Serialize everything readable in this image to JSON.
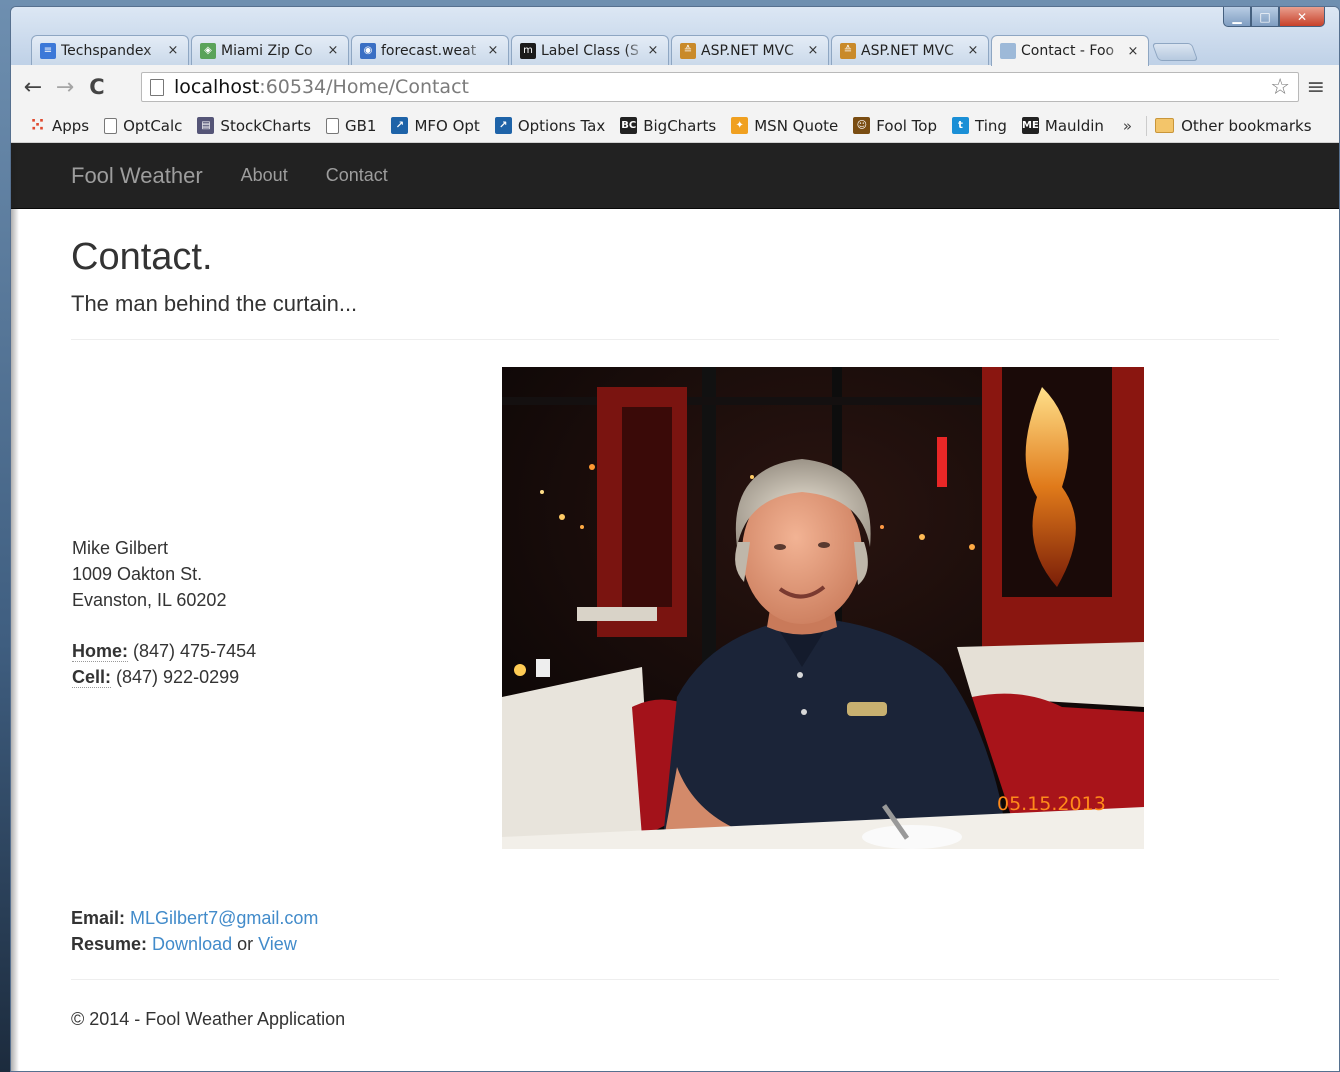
{
  "window": {
    "minimize": "▁",
    "maximize": "□",
    "close": "✕"
  },
  "tabs": [
    {
      "title": "Techspandex",
      "icon": "docs-icon",
      "color": "#3c78d8",
      "glyph": "≡"
    },
    {
      "title": "Miami Zip Co",
      "icon": "maps-icon",
      "color": "#5aa35a",
      "glyph": "◈"
    },
    {
      "title": "forecast.weat",
      "icon": "weather-icon",
      "color": "#3a6fc4",
      "glyph": "◉"
    },
    {
      "title": "Label Class (S",
      "icon": "m-icon",
      "color": "#1b1b1b",
      "glyph": "m"
    },
    {
      "title": "ASP.NET MVC",
      "icon": "stack-icon",
      "color": "#c98a2a",
      "glyph": "≙"
    },
    {
      "title": "ASP.NET MVC",
      "icon": "stack-icon",
      "color": "#c98a2a",
      "glyph": "≙"
    },
    {
      "title": "Contact - Foo",
      "icon": "page-icon",
      "color": "#9db9d8",
      "glyph": ""
    }
  ],
  "tab_close": "×",
  "toolbar": {
    "back": "←",
    "forward": "→",
    "reload": "C",
    "url_host": "localhost",
    "url_rest": ":60534/Home/Contact",
    "star": "☆",
    "menu": "≡"
  },
  "bookmarks": [
    {
      "label": "Apps",
      "icon": "apps-icon",
      "color": "#e04a2f",
      "glyph": "⁙"
    },
    {
      "label": "OptCalc",
      "icon": "doc-icon",
      "color": "",
      "glyph": ""
    },
    {
      "label": "StockCharts",
      "icon": "chart-icon",
      "color": "#557",
      "glyph": "▤"
    },
    {
      "label": "GB1",
      "icon": "doc-icon",
      "color": "",
      "glyph": ""
    },
    {
      "label": "MFO Opt",
      "icon": "runner-icon",
      "color": "#1e63a8",
      "glyph": "↗"
    },
    {
      "label": "Options Tax",
      "icon": "runner-icon",
      "color": "#1e63a8",
      "glyph": "↗"
    },
    {
      "label": "BigCharts",
      "icon": "bigcharts-icon",
      "color": "#222",
      "glyph": "BC"
    },
    {
      "label": "MSN Quote",
      "icon": "msn-icon",
      "color": "#f0a020",
      "glyph": "✦"
    },
    {
      "label": "Fool Top",
      "icon": "fool-icon",
      "color": "#7a4d12",
      "glyph": "☺"
    },
    {
      "label": "Ting",
      "icon": "ting-icon",
      "color": "#1a8fd6",
      "glyph": "t"
    },
    {
      "label": "Mauldin",
      "icon": "me-icon",
      "color": "#222",
      "glyph": "ME"
    }
  ],
  "bookmarks_more": "»",
  "other_bookmarks": "Other bookmarks",
  "site": {
    "brand": "Fool Weather",
    "nav": [
      "About",
      "Contact"
    ],
    "title": "Contact.",
    "subtitle": "The man behind the curtain...",
    "address": {
      "name": "Mike Gilbert",
      "street": "1009 Oakton St.",
      "city": "Evanston, IL 60202",
      "home_label": "Home:",
      "home": " (847) 475-7454",
      "cell_label": "Cell:",
      "cell": " (847) 922-0299"
    },
    "photo_date": "05.15.2013",
    "email_label": "Email:",
    "email": "MLGilbert7@gmail.com",
    "resume_label": "Resume:",
    "resume_download": "Download",
    "resume_or": " or ",
    "resume_view": "View",
    "footer": "© 2014 - Fool Weather Application"
  }
}
